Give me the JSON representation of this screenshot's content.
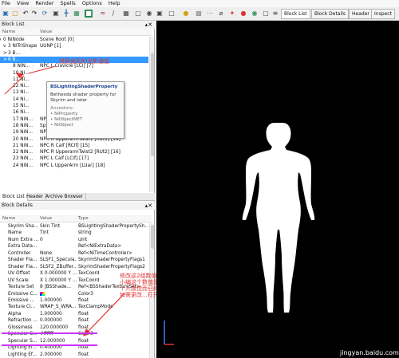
{
  "menu": [
    "File",
    "View",
    "Render",
    "Spells",
    "Options",
    "Help"
  ],
  "toolbar": {
    "icons": [
      "save-icon",
      "folder-icon",
      "undo-icon",
      "redo-icon",
      "refresh-icon",
      "cube-icon",
      "axes-icon",
      "grid-icon",
      "eye-icon",
      "camera-icon",
      "lightbulb-icon",
      "texture-icon",
      "vertex-icon",
      "skeleton-icon",
      "collision-icon",
      "marker-icon",
      "record-icon",
      "palette-icon",
      "ruler-icon",
      "list-icon"
    ],
    "tabs": [
      "Block List",
      "Block Details",
      "Header",
      "Inspect"
    ]
  },
  "block_list": {
    "title": "Block List",
    "col_name": "Name",
    "col_value": "Value",
    "rows": [
      {
        "name": "0 NiNode",
        "value": "Scene Root [0]"
      },
      {
        "name": "3 NiTriShape",
        "value": "UUNP [1]"
      },
      {
        "name": "3 B...",
        "value": ""
      },
      {
        "name": "6 B...",
        "value": ""
      },
      {
        "name": "8 NiN...",
        "value": "NPC L Clavicle [LCl] [7]"
      },
      {
        "name": "10 Ni...",
        "value": ""
      },
      {
        "name": "11 Ni...",
        "value": ""
      },
      {
        "name": "12 Ni...",
        "value": ""
      },
      {
        "name": "13 Ni...",
        "value": ""
      },
      {
        "name": "14 Ni...",
        "value": ""
      },
      {
        "name": "15 Ni...",
        "value": ""
      },
      {
        "name": "16 Ni...",
        "value": ""
      },
      {
        "name": "17 NiN...",
        "value": "NPC R UpperArm [RUar] [11]"
      },
      {
        "name": "18 NiN...",
        "value": "Spine1 [Spn1] [12]"
      },
      {
        "name": "19 NiN...",
        "value": "NPC R UpperarmTwist1 [RUt1] [13]"
      },
      {
        "name": "20 NiN...",
        "value": "NPC R UpperarmTwist1 [RUt1] [14]"
      },
      {
        "name": "21 NiN...",
        "value": "NPC R Calf [RClf] [15]"
      },
      {
        "name": "22 NiN...",
        "value": "NPC R UpperarmTwist2 [RUt2] [16]"
      },
      {
        "name": "23 NiN...",
        "value": "NPC L Calf [LClf] [17]"
      },
      {
        "name": "24 NiN...",
        "value": "NPC L UpperArm [LUar] [18]"
      }
    ],
    "tooltip": {
      "title": "BSLightingShaderProperty",
      "desc": "Bethesda shader property for Skyrim and later",
      "ancestors_label": "Ancestors:",
      "ancestors": [
        "NiProperty",
        "NiObjectNET",
        "NiObject"
      ]
    },
    "bottom_tabs": [
      "Block List",
      "Header",
      "Archive Browser"
    ]
  },
  "block_details": {
    "title": "Block Details",
    "col_name": "Name",
    "col_value": "Value",
    "col_type": "Type",
    "rows": [
      {
        "name": "Skyrim Sha...",
        "value": "Skin Tint",
        "type": "BSLightingShaderPropertySh..."
      },
      {
        "name": "Name",
        "value": "Tint",
        "type": "string"
      },
      {
        "name": "Num Extra ...",
        "value": "0",
        "type": "uint"
      },
      {
        "name": "Extra Data...",
        "value": "",
        "type": "Ref<NiExtraData>"
      },
      {
        "name": "Controller",
        "value": "None",
        "type": "Ref<NiTimeController>"
      },
      {
        "name": "Shader Fla...",
        "value": "SLSF1_Specula...",
        "type": "SkyrimShaderPropertyFlags1"
      },
      {
        "name": "Shader Fla...",
        "value": "SLSF2_ZBuffer...",
        "type": "SkyrimShaderPropertyFlags2"
      },
      {
        "name": "UV Offset",
        "value": "X 0.000000 Y ...",
        "type": "TexCoord"
      },
      {
        "name": "UV Scale",
        "value": "X 1.000000 Y ...",
        "type": "TexCoord"
      },
      {
        "name": "Texture Set",
        "value": "8 [BSShade...",
        "type": "Ref<BSShaderTextureSet>"
      },
      {
        "name": "Emissive C...",
        "value": "",
        "type": "Color3"
      },
      {
        "name": "Emissive ...",
        "value": "1.000000",
        "type": "float"
      },
      {
        "name": "Texture Cl...",
        "value": "WRAP_S_WRA...",
        "type": "TexClampMode"
      },
      {
        "name": "Alpha",
        "value": "1.000000",
        "type": "float"
      },
      {
        "name": "Refraction ...",
        "value": "0.000000",
        "type": "float"
      },
      {
        "name": "Glossiness",
        "value": "120.000000",
        "type": "float"
      },
      {
        "name": "Specular C...",
        "value": "#ffffff",
        "type": "Color3"
      },
      {
        "name": "Specular S...",
        "value": "12.000000",
        "type": "float"
      },
      {
        "name": "Lighting Ef...",
        "value": "0.400000",
        "type": "float"
      },
      {
        "name": "Lighting Ef...",
        "value": "2.000000",
        "type": "float"
      }
    ]
  },
  "annotations": {
    "shadow_channel": "找到身形的光影通道",
    "edit_note": [
      "修改这2组数值,",
      "小编这个数值是自己",
      "个人感觉而已的,",
      "如需更改...打开20即可"
    ]
  },
  "watermark": "jingyan.baidu.com",
  "colors": {
    "selected": "#3399ff",
    "annotation": "#e0302f",
    "highlight": "#cc33ff",
    "viewport": "#000000"
  }
}
